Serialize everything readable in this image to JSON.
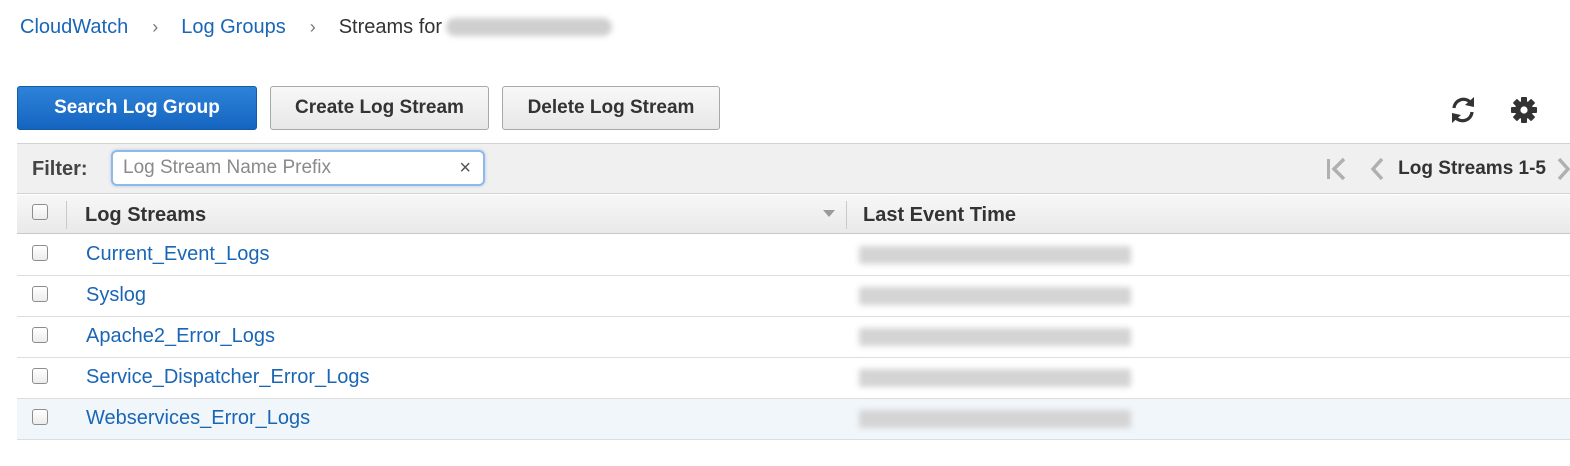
{
  "breadcrumb": {
    "items": [
      "CloudWatch",
      "Log Groups"
    ],
    "separator": "›",
    "current_prefix": "Streams for"
  },
  "toolbar": {
    "search_label": "Search Log Group",
    "create_label": "Create Log Stream",
    "delete_label": "Delete Log Stream",
    "refresh_icon": "refresh-icon",
    "settings_icon": "gear-icon"
  },
  "filter": {
    "label": "Filter:",
    "placeholder": "Log Stream Name Prefix",
    "value": "",
    "clear_icon": "×"
  },
  "pager": {
    "label": "Log Streams 1-5"
  },
  "table": {
    "columns": [
      "Log Streams",
      "Last Event Time"
    ],
    "rows": [
      {
        "name": "Current_Event_Logs",
        "selected": false
      },
      {
        "name": "Syslog",
        "selected": false
      },
      {
        "name": "Apache2_Error_Logs",
        "selected": false
      },
      {
        "name": "Service_Dispatcher_Error_Logs",
        "selected": false
      },
      {
        "name": "Webservices_Error_Logs",
        "selected": true
      }
    ]
  },
  "colors": {
    "link": "#1a66b6",
    "primary_button": "#1565c0",
    "selected_row": "#f1f6fb"
  }
}
